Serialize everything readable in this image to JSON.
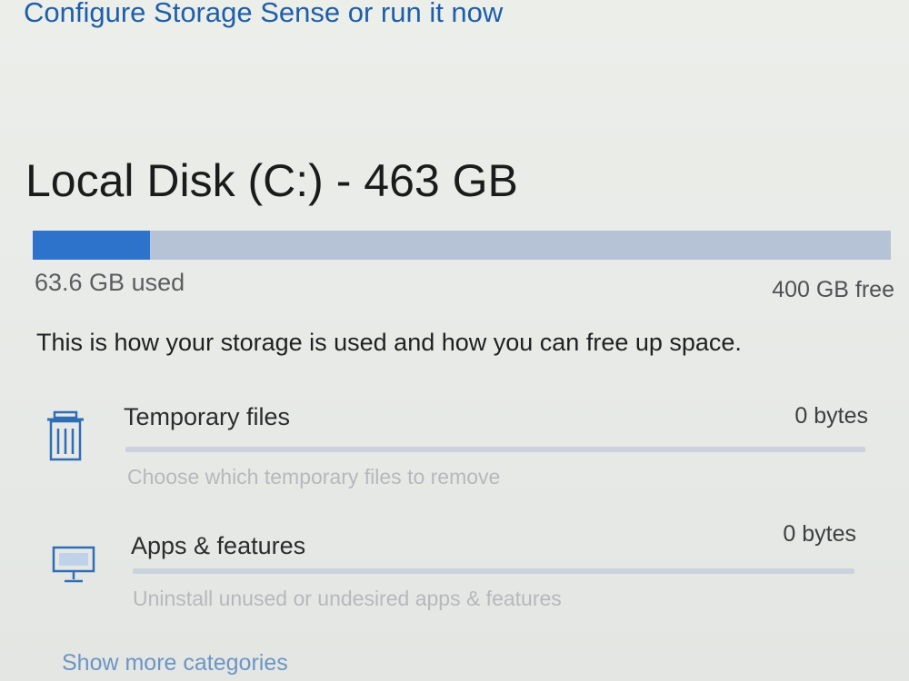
{
  "header": {
    "configure_link": "Configure Storage Sense or run it now"
  },
  "disk": {
    "title": "Local Disk (C:) - 463 GB",
    "used_label": "63.6 GB used",
    "free_label": "400 GB free",
    "used_fraction": 0.137,
    "bar_color": "#2d73cc",
    "bar_track_color": "#b6c3d6"
  },
  "description": "This is how your storage is used and how you can free up space.",
  "categories": [
    {
      "icon": "trash-icon",
      "title": "Temporary files",
      "size": "0 bytes",
      "subtitle": "Choose which temporary files to remove"
    },
    {
      "icon": "monitor-icon",
      "title": "Apps & features",
      "size": "0 bytes",
      "subtitle": "Uninstall unused or undesired apps & features"
    }
  ],
  "show_more": "Show more categories"
}
